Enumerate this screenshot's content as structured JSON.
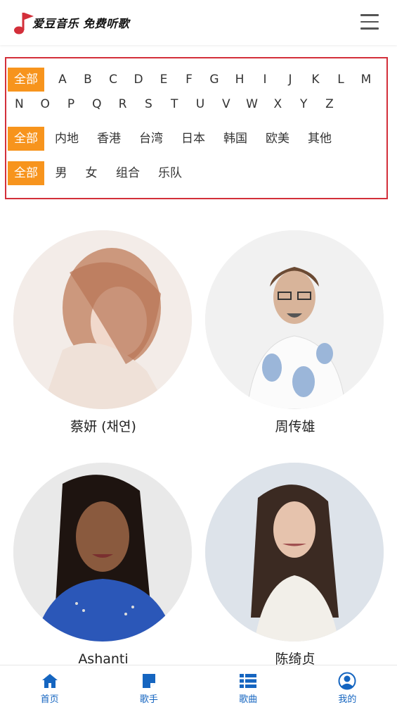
{
  "header": {
    "logo_text": "爱豆音乐 免费听歌",
    "logo_icon": "music-note-flag-icon",
    "menu_icon": "hamburger-menu-icon"
  },
  "filters": {
    "letters_row1": [
      "全部",
      "A",
      "B",
      "C",
      "D",
      "E",
      "F",
      "G",
      "H",
      "I",
      "J",
      "K",
      "L",
      "M"
    ],
    "letters_row2": [
      "N",
      "O",
      "P",
      "Q",
      "R",
      "S",
      "T",
      "U",
      "V",
      "W",
      "X",
      "Y",
      "Z"
    ],
    "regions": [
      "全部",
      "内地",
      "香港",
      "台湾",
      "日本",
      "韩国",
      "欧美",
      "其他"
    ],
    "genders": [
      "全部",
      "男",
      "女",
      "组合",
      "乐队"
    ],
    "active_color": "#f7941d",
    "border_color": "#d32f3a"
  },
  "artists": [
    {
      "name": "蔡妍 (채연)"
    },
    {
      "name": "周传雄"
    },
    {
      "name": "Ashanti"
    },
    {
      "name": "陈绮贞"
    }
  ],
  "tabbar": {
    "color": "#1565c0",
    "items": [
      {
        "label": "首页",
        "icon": "home-icon"
      },
      {
        "label": "歌手",
        "icon": "singer-note-icon"
      },
      {
        "label": "歌曲",
        "icon": "list-icon"
      },
      {
        "label": "我的",
        "icon": "user-circle-icon"
      }
    ]
  }
}
